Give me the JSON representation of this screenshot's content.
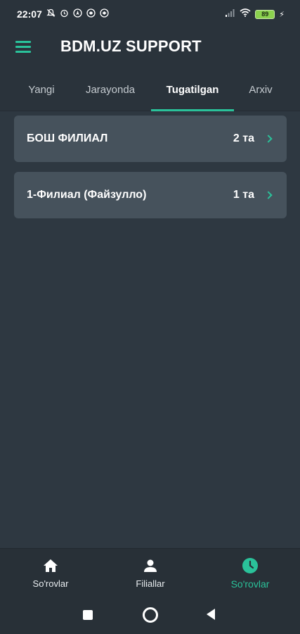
{
  "status_bar": {
    "time": "22:07",
    "battery": "89",
    "left_icons": [
      "mute-icon",
      "alarm-icon",
      "navigation-icon",
      "vpn-icon",
      "vpn-icon"
    ],
    "right_icons": [
      "signal-icon",
      "wifi-icon",
      "battery-icon",
      "charging-icon"
    ]
  },
  "app_bar": {
    "title": "BDM.UZ SUPPORT",
    "menu_icon": "hamburger-menu-icon"
  },
  "tabs": [
    {
      "label": "Yangi",
      "active": false
    },
    {
      "label": "Jarayonda",
      "active": false
    },
    {
      "label": "Tugatilgan",
      "active": true
    },
    {
      "label": "Arxiv",
      "active": false
    }
  ],
  "branches": [
    {
      "name": "БОШ ФИЛИАЛ",
      "count": "2 та"
    },
    {
      "name": "1-Филиал (Файзулло)",
      "count": "1 та"
    }
  ],
  "bottom_nav": [
    {
      "label": "So'rovlar",
      "icon": "home-icon",
      "active": false
    },
    {
      "label": "Filiallar",
      "icon": "person-icon",
      "active": false
    },
    {
      "label": "So'rovlar",
      "icon": "clock-icon",
      "active": true
    }
  ],
  "colors": {
    "accent": "#2ac29a",
    "background": "#2e3841",
    "card": "#46525c",
    "bar": "#2a333b"
  }
}
